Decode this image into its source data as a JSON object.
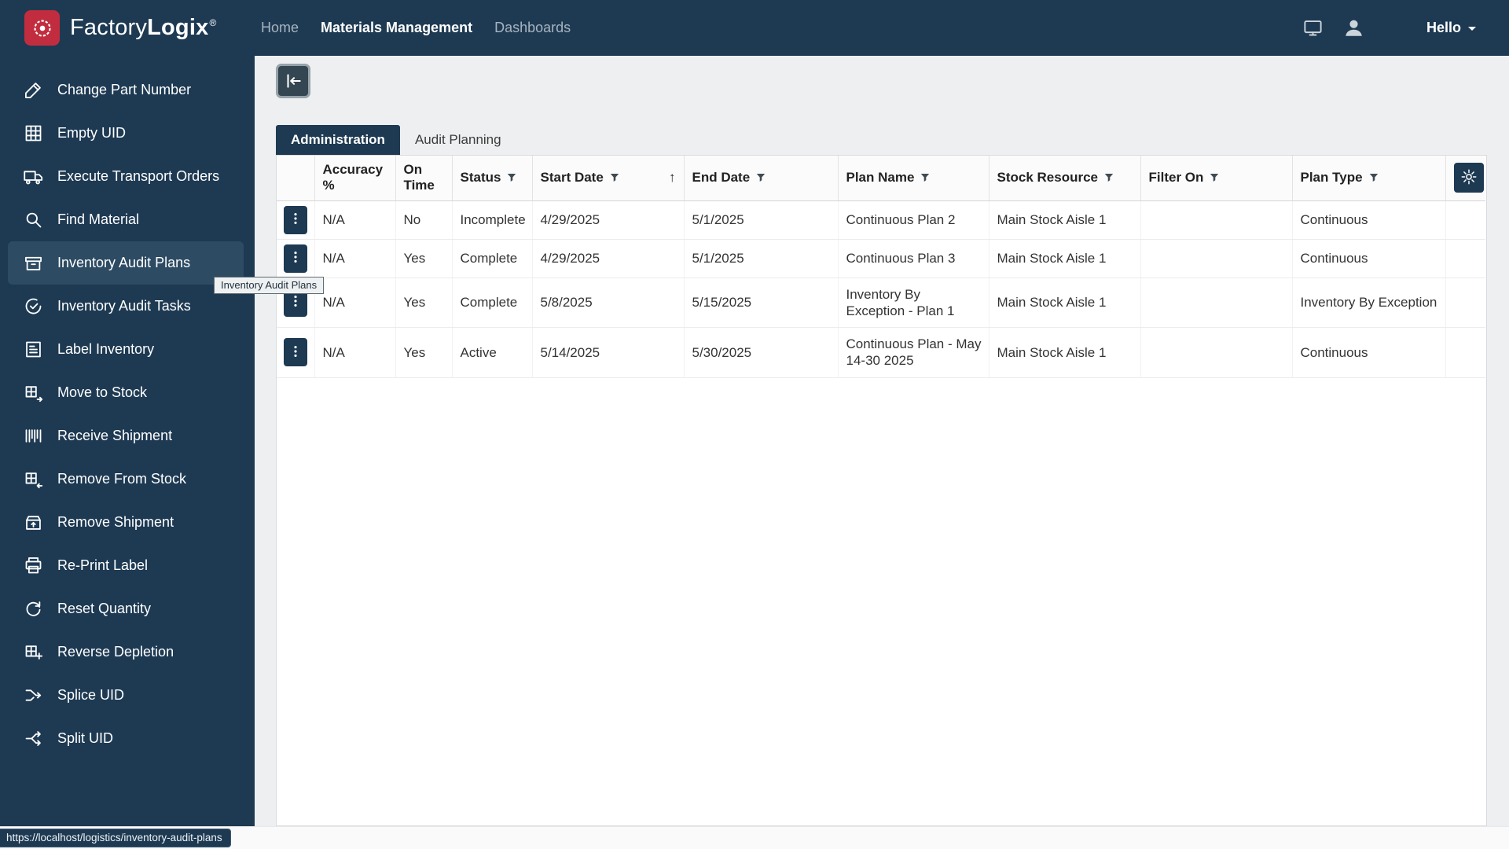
{
  "brand": {
    "light": "Factory",
    "bold": "Logix",
    "registered": "®"
  },
  "header": {
    "nav": [
      {
        "label": "Home",
        "active": false
      },
      {
        "label": "Materials Management",
        "active": true
      },
      {
        "label": "Dashboards",
        "active": false
      }
    ],
    "icons": [
      "display-icon",
      "user-icon"
    ],
    "greeting": "Hello"
  },
  "sidebar": {
    "active_index": 4,
    "tooltip": "Inventory Audit Plans",
    "items": [
      {
        "label": "Change Part Number",
        "icon": "edit-icon"
      },
      {
        "label": "Empty UID",
        "icon": "grid-icon"
      },
      {
        "label": "Execute Transport Orders",
        "icon": "truck-icon"
      },
      {
        "label": "Find Material",
        "icon": "search-icon"
      },
      {
        "label": "Inventory Audit Plans",
        "icon": "archive-icon"
      },
      {
        "label": "Inventory Audit Tasks",
        "icon": "check-circle-icon"
      },
      {
        "label": "Label Inventory",
        "icon": "document-icon"
      },
      {
        "label": "Move to Stock",
        "icon": "box-arrow-in-icon"
      },
      {
        "label": "Receive Shipment",
        "icon": "barcode-icon"
      },
      {
        "label": "Remove From Stock",
        "icon": "box-arrow-out-icon"
      },
      {
        "label": "Remove Shipment",
        "icon": "box-up-icon"
      },
      {
        "label": "Re-Print Label",
        "icon": "printer-icon"
      },
      {
        "label": "Reset Quantity",
        "icon": "refresh-icon"
      },
      {
        "label": "Reverse Depletion",
        "icon": "box-plus-icon"
      },
      {
        "label": "Splice UID",
        "icon": "merge-icon"
      },
      {
        "label": "Split UID",
        "icon": "split-icon"
      }
    ]
  },
  "main": {
    "tabs": [
      {
        "label": "Administration",
        "active": true
      },
      {
        "label": "Audit Planning",
        "active": false
      }
    ],
    "table": {
      "columns": [
        {
          "key": "menu",
          "label": ""
        },
        {
          "key": "accuracy",
          "label": "Accuracy %"
        },
        {
          "key": "on_time",
          "label": "On Time"
        },
        {
          "key": "status",
          "label": "Status",
          "filterable": true
        },
        {
          "key": "start_date",
          "label": "Start Date",
          "filterable": true,
          "sorted": "asc"
        },
        {
          "key": "end_date",
          "label": "End Date",
          "filterable": true
        },
        {
          "key": "plan_name",
          "label": "Plan Name",
          "filterable": true
        },
        {
          "key": "stock_resource",
          "label": "Stock Resource",
          "filterable": true
        },
        {
          "key": "filter_on",
          "label": "Filter On",
          "filterable": true
        },
        {
          "key": "plan_type",
          "label": "Plan Type",
          "filterable": true
        },
        {
          "key": "settings",
          "label": ""
        }
      ],
      "sort_indicator": "↑",
      "rows": [
        {
          "accuracy": "N/A",
          "on_time": "No",
          "status": "Incomplete",
          "status_alert": true,
          "start_date": "4/29/2025",
          "end_date": "5/1/2025",
          "end_alert": true,
          "plan_name": "Continuous Plan 2",
          "stock_resource": "Main Stock Aisle 1",
          "filter_on": "",
          "plan_type": "Continuous"
        },
        {
          "accuracy": "N/A",
          "on_time": "Yes",
          "status": "Complete",
          "status_alert": false,
          "start_date": "4/29/2025",
          "end_date": "5/1/2025",
          "end_alert": true,
          "plan_name": "Continuous Plan 3",
          "stock_resource": "Main Stock Aisle 1",
          "filter_on": "",
          "plan_type": "Continuous"
        },
        {
          "accuracy": "N/A",
          "on_time": "Yes",
          "status": "Complete",
          "status_alert": false,
          "start_date": "5/8/2025",
          "end_date": "5/15/2025",
          "end_alert": true,
          "plan_name": "Inventory By Exception - Plan 1",
          "stock_resource": "Main Stock Aisle 1",
          "filter_on": "",
          "plan_type": "Inventory By Exception"
        },
        {
          "accuracy": "N/A",
          "on_time": "Yes",
          "status": "Active",
          "status_alert": false,
          "start_date": "5/14/2025",
          "end_date": "5/30/2025",
          "end_alert": false,
          "plan_name": "Continuous Plan - May 14-30 2025",
          "stock_resource": "Main Stock Aisle 1",
          "filter_on": "",
          "plan_type": "Continuous"
        }
      ]
    }
  },
  "statusbar": {
    "url": "https://localhost/logistics/inventory-audit-plans"
  },
  "colors": {
    "navy": "#1e3a53",
    "navy_active": "#2d4b63",
    "red": "#e0445a",
    "brand_red": "#c12d3f"
  }
}
